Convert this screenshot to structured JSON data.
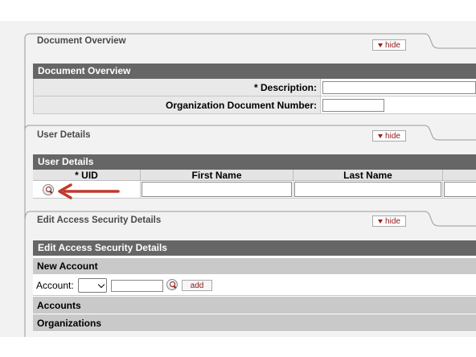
{
  "tabs": {
    "document_overview": {
      "title": "Document Overview",
      "hide_label": "hide"
    },
    "user_details": {
      "title": "User Details",
      "hide_label": "hide"
    },
    "edit_access": {
      "title": "Edit Access Security Details",
      "hide_label": "hide"
    }
  },
  "document_overview": {
    "header": "Document Overview",
    "description_label": "*  Description:",
    "description_value": "",
    "org_doc_number_label": "Organization Document Number:",
    "org_doc_number_value": ""
  },
  "user_details": {
    "header": "User Details",
    "columns": [
      "*  UID",
      "First Name",
      "Last Name",
      ""
    ],
    "row": {
      "uid": "",
      "first_name": "",
      "last_name": ""
    }
  },
  "edit_access": {
    "header": "Edit Access Security Details",
    "new_account_header": "New Account",
    "account_label": "Account:",
    "account_chart_selected": "",
    "account_number_value": "",
    "add_label": "add",
    "accounts_header": "Accounts",
    "organizations_header": "Organizations"
  },
  "icons": {
    "lookup": "magnifier-lookup-icon",
    "hide_triangle": "triangle-down-icon",
    "annotation": "red-arrow-icon"
  },
  "colors": {
    "section_header_bg": "#666666",
    "label_bg": "#e9e9e9",
    "hide_text": "#8b1a1a",
    "annotation_arrow": "#c0392b"
  }
}
